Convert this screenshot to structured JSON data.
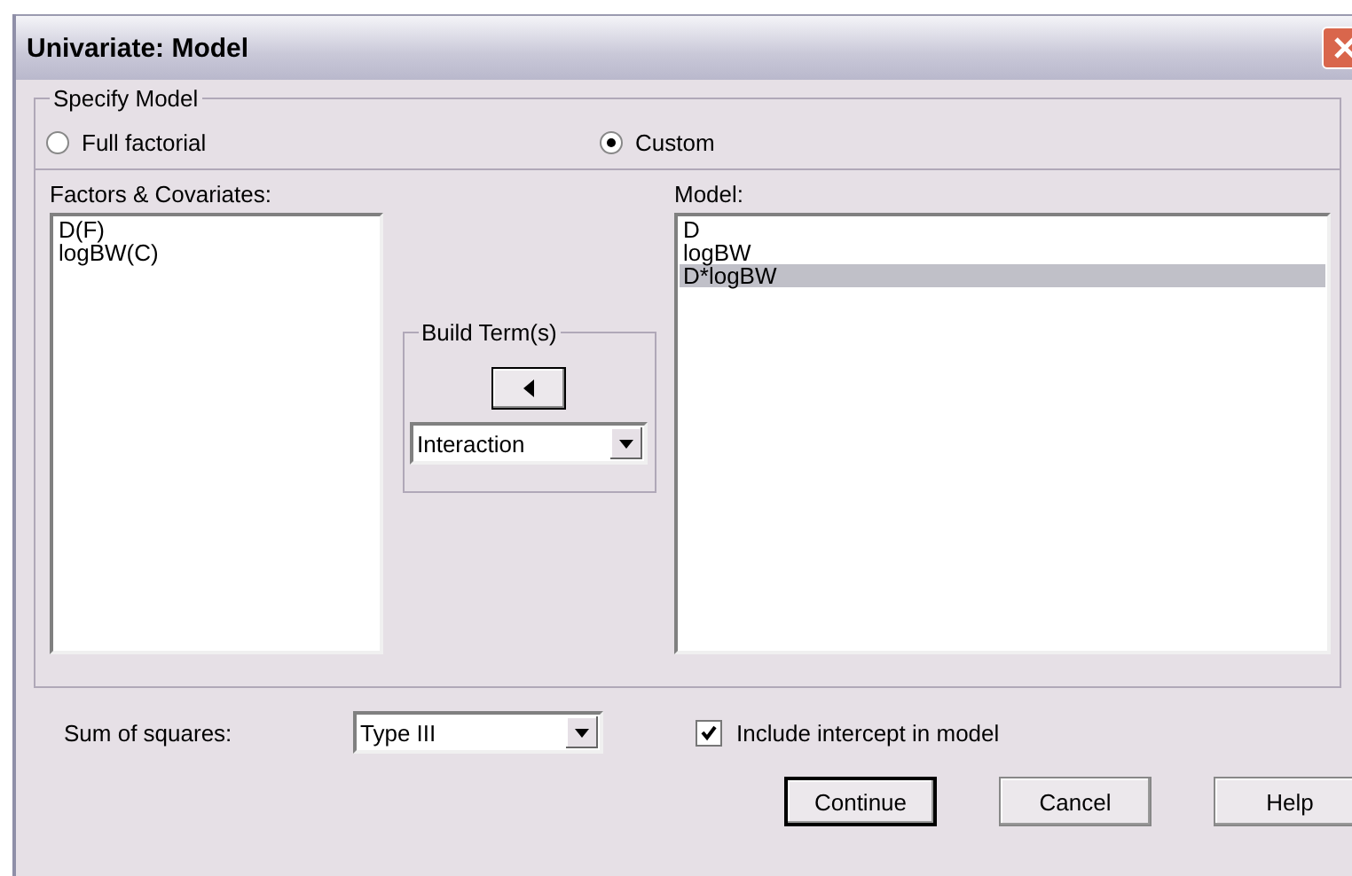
{
  "window": {
    "title": "Univariate: Model"
  },
  "specify_model": {
    "legend": "Specify Model",
    "options": [
      {
        "label": "Full factorial",
        "selected": false
      },
      {
        "label": "Custom",
        "selected": true
      }
    ]
  },
  "factors_covariates": {
    "label": "Factors & Covariates:",
    "items": [
      {
        "text": "D(F)",
        "selected": false
      },
      {
        "text": "logBW(C)",
        "selected": false
      }
    ]
  },
  "build_terms": {
    "legend": "Build Term(s)",
    "type": "Interaction"
  },
  "model": {
    "label": "Model:",
    "items": [
      {
        "text": "D",
        "selected": false
      },
      {
        "text": "logBW",
        "selected": false
      },
      {
        "text": "D*logBW",
        "selected": true
      }
    ]
  },
  "sum_of_squares": {
    "label": "Sum of squares:",
    "value": "Type III"
  },
  "include_intercept": {
    "label": "Include intercept in model",
    "checked": true
  },
  "buttons": [
    {
      "label": "Continue",
      "default": true
    },
    {
      "label": "Cancel",
      "default": false
    },
    {
      "label": "Help",
      "default": false
    }
  ]
}
